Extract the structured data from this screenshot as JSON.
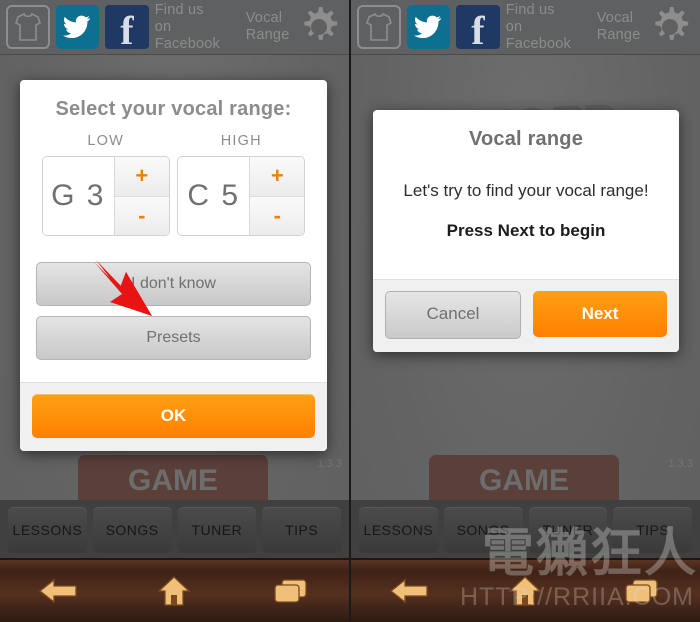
{
  "toolbar": {
    "tshirt_icon": "tshirt-icon",
    "twitter_icon": "twitter-icon",
    "facebook_icon": "facebook-icon",
    "facebook_label": "Find us on\nFacebook",
    "vocal_range_label": "Vocal\nRange",
    "gear_icon": "gear-icon"
  },
  "background": {
    "logo_text": "SINGER",
    "game_button": "GAME",
    "version": "1.3.3"
  },
  "left_dialog": {
    "title": "Select your vocal range:",
    "low": {
      "header": "LOW",
      "value": "G 3",
      "plus": "+",
      "minus": "-"
    },
    "high": {
      "header": "HIGH",
      "value": "C 5",
      "plus": "+",
      "minus": "-"
    },
    "i_dont_know": "I don't know",
    "presets": "Presets",
    "ok": "OK"
  },
  "right_dialog": {
    "title": "Vocal range",
    "message": "Let's try to find your vocal range!",
    "prompt": "Press Next to begin",
    "cancel": "Cancel",
    "next": "Next"
  },
  "tabs": [
    "LESSONS",
    "SONGS",
    "TUNER",
    "TIPS"
  ],
  "navbar": {
    "back_icon": "back-arrow-icon",
    "home_icon": "home-icon",
    "recents_icon": "recent-apps-icon"
  },
  "watermark": {
    "cjk": "電獺狂人",
    "url": "HTTP://RRIIA.COM"
  },
  "colors": {
    "accent_orange": "#ff8000",
    "twitter_blue": "#0e7090",
    "facebook_blue": "#1f3864",
    "arrow_red": "#e81414",
    "toolbar_gray": "#5f6061",
    "tab_bar": "#404040"
  }
}
